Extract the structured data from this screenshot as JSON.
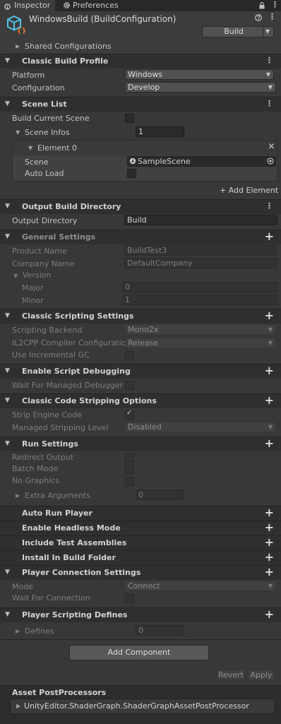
{
  "tabs": [
    {
      "label": "Inspector"
    },
    {
      "label": "Preferences"
    }
  ],
  "header": {
    "title": "WindowsBuild (BuildConfiguration)",
    "build_label": "Build",
    "shared": "Shared Configurations"
  },
  "classic_build_profile": {
    "title": "Classic Build Profile",
    "platform_label": "Platform",
    "platform_value": "Windows",
    "configuration_label": "Configuration",
    "configuration_value": "Develop"
  },
  "scene_list": {
    "title": "Scene List",
    "build_current_label": "Build Current Scene",
    "scene_infos_label": "Scene Infos",
    "scene_infos_count": "1",
    "element_label": "Element 0",
    "scene_label": "Scene",
    "scene_value": "SampleScene",
    "auto_load_label": "Auto Load",
    "add_element": "+ Add Element"
  },
  "output_dir": {
    "title": "Output Build Directory",
    "label": "Output Directory",
    "value": "Build"
  },
  "general": {
    "title": "General Settings",
    "product_label": "Product Name",
    "product_value": "BuildTest3",
    "company_label": "Company Name",
    "company_value": "DefaultCompany",
    "version_label": "Version",
    "major_label": "Major",
    "major_value": "0",
    "minor_label": "Minor",
    "minor_value": "1"
  },
  "scripting": {
    "title": "Classic Scripting Settings",
    "backend_label": "Scripting Backend",
    "backend_value": "Mono2x",
    "il2cpp_label": "IL2CPP Compiler Configuration",
    "il2cpp_value": "Release",
    "incgc_label": "Use Incremental GC"
  },
  "debugging": {
    "title": "Enable Script Debugging",
    "wait_label": "Wait For Managed Debugger"
  },
  "stripping": {
    "title": "Classic Code Stripping Options",
    "strip_label": "Strip Engine Code",
    "level_label": "Managed Stripping Level",
    "level_value": "Disabled"
  },
  "run": {
    "title": "Run Settings",
    "redirect_label": "Redirect Output",
    "batch_label": "Batch Mode",
    "nographics_label": "No Graphics",
    "extra_label": "Extra Arguments",
    "extra_value": "0"
  },
  "collapsed": [
    {
      "title": "Auto Run Player"
    },
    {
      "title": "Enable Headless Mode"
    },
    {
      "title": "Include Test Assemblies"
    },
    {
      "title": "Install In Build Folder"
    }
  ],
  "player_conn": {
    "title": "Player Connection Settings",
    "mode_label": "Mode",
    "mode_value": "Connect",
    "wait_label": "Wait For Connection"
  },
  "defines": {
    "title": "Player Scripting Defines",
    "label": "Defines",
    "value": "0"
  },
  "footer": {
    "add_component": "Add Component",
    "revert": "Revert",
    "apply": "Apply",
    "postprocessors_title": "Asset PostProcessors",
    "postprocessor_item": "UnityEditor.ShaderGraph.ShaderGraphAssetPostProcessor"
  },
  "icons": {
    "tab_lock": "lock-icon",
    "tab_menu": "kebab-menu-icon",
    "config": "build-config-asset-icon",
    "gear": "gear-icon"
  }
}
